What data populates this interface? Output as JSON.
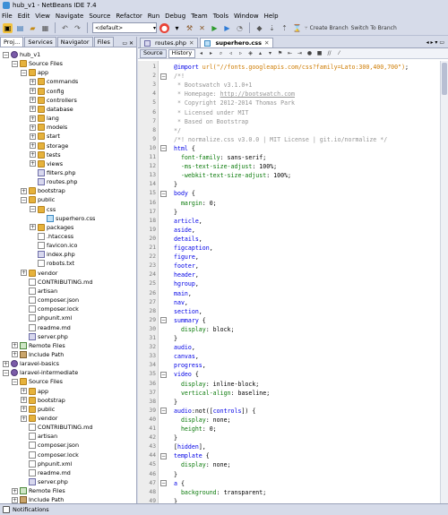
{
  "window": {
    "title": "hub_v1 - NetBeans IDE 7.4"
  },
  "menu": [
    "File",
    "Edit",
    "View",
    "Navigate",
    "Source",
    "Refactor",
    "Run",
    "Debug",
    "Team",
    "Tools",
    "Window",
    "Help"
  ],
  "toolbar": {
    "config": "<default>",
    "create_branch": "Create Branch",
    "switch_branch": "Switch To Branch"
  },
  "left_tabs": [
    "Proj...",
    "Services",
    "Navigator",
    "Files"
  ],
  "tree": [
    {
      "label": "hub_v1",
      "depth": 0,
      "icon": "project",
      "exp": "−"
    },
    {
      "label": "Source Files",
      "depth": 1,
      "icon": "folder",
      "exp": "−"
    },
    {
      "label": "app",
      "depth": 2,
      "icon": "folder",
      "exp": "−"
    },
    {
      "label": "commands",
      "depth": 3,
      "icon": "folder",
      "exp": "+"
    },
    {
      "label": "config",
      "depth": 3,
      "icon": "folder",
      "exp": "+"
    },
    {
      "label": "controllers",
      "depth": 3,
      "icon": "folder",
      "exp": "+"
    },
    {
      "label": "database",
      "depth": 3,
      "icon": "folder",
      "exp": "+"
    },
    {
      "label": "lang",
      "depth": 3,
      "icon": "folder",
      "exp": "+"
    },
    {
      "label": "models",
      "depth": 3,
      "icon": "folder",
      "exp": "+"
    },
    {
      "label": "start",
      "depth": 3,
      "icon": "folder",
      "exp": "+"
    },
    {
      "label": "storage",
      "depth": 3,
      "icon": "folder",
      "exp": "+"
    },
    {
      "label": "tests",
      "depth": 3,
      "icon": "folder",
      "exp": "+"
    },
    {
      "label": "views",
      "depth": 3,
      "icon": "folder",
      "exp": "+"
    },
    {
      "label": "filters.php",
      "depth": 3,
      "icon": "php",
      "exp": ""
    },
    {
      "label": "routes.php",
      "depth": 3,
      "icon": "php",
      "exp": ""
    },
    {
      "label": "bootstrap",
      "depth": 2,
      "icon": "folder",
      "exp": "+"
    },
    {
      "label": "public",
      "depth": 2,
      "icon": "folder",
      "exp": "−"
    },
    {
      "label": "css",
      "depth": 3,
      "icon": "folder",
      "exp": "−"
    },
    {
      "label": "superhero.css",
      "depth": 4,
      "icon": "css",
      "exp": ""
    },
    {
      "label": "packages",
      "depth": 3,
      "icon": "folder",
      "exp": "+"
    },
    {
      "label": ".htaccess",
      "depth": 3,
      "icon": "file",
      "exp": ""
    },
    {
      "label": "favicon.ico",
      "depth": 3,
      "icon": "file",
      "exp": ""
    },
    {
      "label": "index.php",
      "depth": 3,
      "icon": "php",
      "exp": ""
    },
    {
      "label": "robots.txt",
      "depth": 3,
      "icon": "file",
      "exp": ""
    },
    {
      "label": "vendor",
      "depth": 2,
      "icon": "folder",
      "exp": "+"
    },
    {
      "label": "CONTRIBUTING.md",
      "depth": 2,
      "icon": "file",
      "exp": ""
    },
    {
      "label": "artisan",
      "depth": 2,
      "icon": "file",
      "exp": ""
    },
    {
      "label": "composer.json",
      "depth": 2,
      "icon": "file",
      "exp": ""
    },
    {
      "label": "composer.lock",
      "depth": 2,
      "icon": "file",
      "exp": ""
    },
    {
      "label": "phpunit.xml",
      "depth": 2,
      "icon": "file",
      "exp": ""
    },
    {
      "label": "readme.md",
      "depth": 2,
      "icon": "file",
      "exp": ""
    },
    {
      "label": "server.php",
      "depth": 2,
      "icon": "php",
      "exp": ""
    },
    {
      "label": "Remote Files",
      "depth": 1,
      "icon": "web",
      "exp": "+"
    },
    {
      "label": "Include Path",
      "depth": 1,
      "icon": "lib",
      "exp": "+"
    },
    {
      "label": "laravel-basics",
      "depth": 0,
      "icon": "project",
      "exp": "+"
    },
    {
      "label": "laravel-intermediate",
      "depth": 0,
      "icon": "project",
      "exp": "−"
    },
    {
      "label": "Source Files",
      "depth": 1,
      "icon": "folder",
      "exp": "−"
    },
    {
      "label": "app",
      "depth": 2,
      "icon": "folder",
      "exp": "+"
    },
    {
      "label": "bootstrap",
      "depth": 2,
      "icon": "folder",
      "exp": "+"
    },
    {
      "label": "public",
      "depth": 2,
      "icon": "folder",
      "exp": "+"
    },
    {
      "label": "vendor",
      "depth": 2,
      "icon": "folder",
      "exp": "+"
    },
    {
      "label": "CONTRIBUTING.md",
      "depth": 2,
      "icon": "file",
      "exp": ""
    },
    {
      "label": "artisan",
      "depth": 2,
      "icon": "file",
      "exp": ""
    },
    {
      "label": "composer.json",
      "depth": 2,
      "icon": "file",
      "exp": ""
    },
    {
      "label": "composer.lock",
      "depth": 2,
      "icon": "file",
      "exp": ""
    },
    {
      "label": "phpunit.xml",
      "depth": 2,
      "icon": "file",
      "exp": ""
    },
    {
      "label": "readme.md",
      "depth": 2,
      "icon": "file",
      "exp": ""
    },
    {
      "label": "server.php",
      "depth": 2,
      "icon": "php",
      "exp": ""
    },
    {
      "label": "Remote Files",
      "depth": 1,
      "icon": "web",
      "exp": "+"
    },
    {
      "label": "Include Path",
      "depth": 1,
      "icon": "lib",
      "exp": "+"
    }
  ],
  "editor_tabs": [
    {
      "label": "routes.php",
      "active": false
    },
    {
      "label": "superhero.css",
      "active": true
    }
  ],
  "editor_modes": [
    "Source",
    "History"
  ],
  "code": [
    {
      "n": "1",
      "fold": "",
      "parts": [
        [
          "kw",
          "@import "
        ],
        [
          "str",
          "url(\"//fonts.googleapis.com/css?family=Lato:300,400,700\")"
        ],
        [
          "punct",
          ";"
        ]
      ]
    },
    {
      "n": "2",
      "fold": "−",
      "parts": [
        [
          "comment",
          "/*!"
        ]
      ]
    },
    {
      "n": "3",
      "fold": "",
      "parts": [
        [
          "comment",
          " * Bootswatch v3.1.0+1"
        ]
      ]
    },
    {
      "n": "4",
      "fold": "",
      "parts": [
        [
          "comment",
          " * Homepage: "
        ],
        [
          "commentul",
          "http://bootswatch.com"
        ]
      ]
    },
    {
      "n": "5",
      "fold": "",
      "parts": [
        [
          "comment",
          " * Copyright 2012-2014 Thomas Park"
        ]
      ]
    },
    {
      "n": "6",
      "fold": "",
      "parts": [
        [
          "comment",
          " * Licensed under MIT"
        ]
      ]
    },
    {
      "n": "7",
      "fold": "",
      "parts": [
        [
          "comment",
          " * Based on Bootstrap"
        ]
      ]
    },
    {
      "n": "8",
      "fold": "",
      "parts": [
        [
          "comment",
          "*/"
        ]
      ]
    },
    {
      "n": "9",
      "fold": "",
      "parts": [
        [
          "comment",
          "/*! normalize.css v3.0.0 | MIT License | git.io/normalize */"
        ]
      ]
    },
    {
      "n": "10",
      "fold": "−",
      "parts": [
        [
          "sel",
          "html "
        ],
        [
          "punct",
          "{"
        ]
      ]
    },
    {
      "n": "11",
      "fold": "",
      "parts": [
        [
          "prop",
          "  font-family"
        ],
        [
          "punct",
          ": sans-serif;"
        ]
      ]
    },
    {
      "n": "12",
      "fold": "",
      "parts": [
        [
          "prop",
          "  -ms-text-size-adjust"
        ],
        [
          "punct",
          ": 100%;"
        ]
      ]
    },
    {
      "n": "13",
      "fold": "",
      "parts": [
        [
          "prop",
          "  -webkit-text-size-adjust"
        ],
        [
          "punct",
          ": 100%;"
        ]
      ]
    },
    {
      "n": "14",
      "fold": "",
      "parts": [
        [
          "punct",
          "}"
        ]
      ]
    },
    {
      "n": "15",
      "fold": "−",
      "parts": [
        [
          "sel",
          "body "
        ],
        [
          "punct",
          "{"
        ]
      ]
    },
    {
      "n": "16",
      "fold": "",
      "parts": [
        [
          "prop",
          "  margin"
        ],
        [
          "punct",
          ": 0;"
        ]
      ]
    },
    {
      "n": "17",
      "fold": "",
      "parts": [
        [
          "punct",
          "}"
        ]
      ]
    },
    {
      "n": "18",
      "fold": "",
      "parts": [
        [
          "sel",
          "article"
        ],
        [
          "punct",
          ","
        ]
      ]
    },
    {
      "n": "19",
      "fold": "",
      "parts": [
        [
          "sel",
          "aside"
        ],
        [
          "punct",
          ","
        ]
      ]
    },
    {
      "n": "20",
      "fold": "",
      "parts": [
        [
          "sel",
          "details"
        ],
        [
          "punct",
          ","
        ]
      ]
    },
    {
      "n": "21",
      "fold": "",
      "parts": [
        [
          "sel",
          "figcaption"
        ],
        [
          "punct",
          ","
        ]
      ]
    },
    {
      "n": "22",
      "fold": "",
      "parts": [
        [
          "sel",
          "figure"
        ],
        [
          "punct",
          ","
        ]
      ]
    },
    {
      "n": "23",
      "fold": "",
      "parts": [
        [
          "sel",
          "footer"
        ],
        [
          "punct",
          ","
        ]
      ]
    },
    {
      "n": "24",
      "fold": "",
      "parts": [
        [
          "sel",
          "header"
        ],
        [
          "punct",
          ","
        ]
      ]
    },
    {
      "n": "25",
      "fold": "",
      "parts": [
        [
          "sel",
          "hgroup"
        ],
        [
          "punct",
          ","
        ]
      ]
    },
    {
      "n": "26",
      "fold": "",
      "parts": [
        [
          "sel",
          "main"
        ],
        [
          "punct",
          ","
        ]
      ]
    },
    {
      "n": "27",
      "fold": "",
      "parts": [
        [
          "sel",
          "nav"
        ],
        [
          "punct",
          ","
        ]
      ]
    },
    {
      "n": "28",
      "fold": "",
      "parts": [
        [
          "sel",
          "section"
        ],
        [
          "punct",
          ","
        ]
      ]
    },
    {
      "n": "29",
      "fold": "−",
      "parts": [
        [
          "sel",
          "summary "
        ],
        [
          "punct",
          "{"
        ]
      ]
    },
    {
      "n": "30",
      "fold": "",
      "parts": [
        [
          "prop",
          "  display"
        ],
        [
          "punct",
          ": block;"
        ]
      ]
    },
    {
      "n": "31",
      "fold": "",
      "parts": [
        [
          "punct",
          "}"
        ]
      ]
    },
    {
      "n": "32",
      "fold": "",
      "parts": [
        [
          "sel",
          "audio"
        ],
        [
          "punct",
          ","
        ]
      ]
    },
    {
      "n": "33",
      "fold": "",
      "parts": [
        [
          "sel",
          "canvas"
        ],
        [
          "punct",
          ","
        ]
      ]
    },
    {
      "n": "34",
      "fold": "",
      "parts": [
        [
          "sel",
          "progress"
        ],
        [
          "punct",
          ","
        ]
      ]
    },
    {
      "n": "35",
      "fold": "−",
      "parts": [
        [
          "sel",
          "video "
        ],
        [
          "punct",
          "{"
        ]
      ]
    },
    {
      "n": "36",
      "fold": "",
      "parts": [
        [
          "prop",
          "  display"
        ],
        [
          "punct",
          ": inline-block;"
        ]
      ]
    },
    {
      "n": "37",
      "fold": "",
      "parts": [
        [
          "prop",
          "  vertical-align"
        ],
        [
          "punct",
          ": baseline;"
        ]
      ]
    },
    {
      "n": "38",
      "fold": "",
      "parts": [
        [
          "punct",
          "}"
        ]
      ]
    },
    {
      "n": "39",
      "fold": "−",
      "parts": [
        [
          "sel",
          "audio"
        ],
        [
          "punct",
          ":not(["
        ],
        [
          "sel",
          "controls"
        ],
        [
          "punct",
          "]) {"
        ]
      ]
    },
    {
      "n": "40",
      "fold": "",
      "parts": [
        [
          "prop",
          "  display"
        ],
        [
          "punct",
          ": none;"
        ]
      ]
    },
    {
      "n": "41",
      "fold": "",
      "parts": [
        [
          "prop",
          "  height"
        ],
        [
          "punct",
          ": 0;"
        ]
      ]
    },
    {
      "n": "42",
      "fold": "",
      "parts": [
        [
          "punct",
          "}"
        ]
      ]
    },
    {
      "n": "43",
      "fold": "",
      "parts": [
        [
          "punct",
          "["
        ],
        [
          "sel",
          "hidden"
        ],
        [
          "punct",
          "],"
        ]
      ]
    },
    {
      "n": "44",
      "fold": "−",
      "parts": [
        [
          "sel",
          "template "
        ],
        [
          "punct",
          "{"
        ]
      ]
    },
    {
      "n": "45",
      "fold": "",
      "parts": [
        [
          "prop",
          "  display"
        ],
        [
          "punct",
          ": none;"
        ]
      ]
    },
    {
      "n": "46",
      "fold": "",
      "parts": [
        [
          "punct",
          "}"
        ]
      ]
    },
    {
      "n": "47",
      "fold": "−",
      "parts": [
        [
          "sel",
          "a "
        ],
        [
          "punct",
          "{"
        ]
      ]
    },
    {
      "n": "48",
      "fold": "",
      "parts": [
        [
          "prop",
          "  background"
        ],
        [
          "punct",
          ": transparent;"
        ]
      ]
    },
    {
      "n": "49",
      "fold": "",
      "parts": [
        [
          "punct",
          "}"
        ]
      ]
    }
  ],
  "status": {
    "notifications": "Notifications"
  },
  "colors": {
    "chrome": "#d6dbe9",
    "keyword": "#0000e6",
    "property": "#0a7a0a",
    "comment": "#969696",
    "string": "#ce7b00"
  }
}
